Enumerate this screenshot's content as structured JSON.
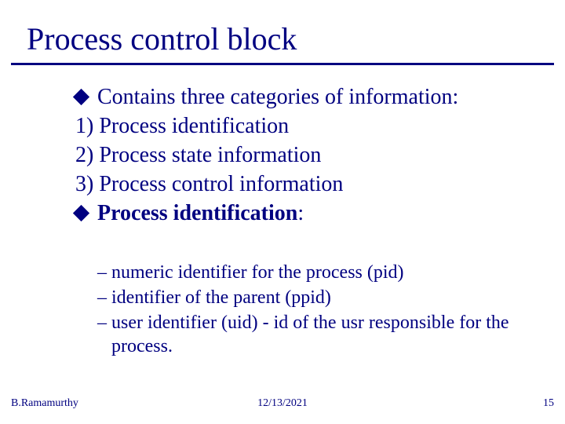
{
  "title": "Process control block",
  "body": {
    "bullet1": "Contains three categories of information:",
    "line1": "1) Process identification",
    "line2": "2) Process state information",
    "line3": "3) Process control information",
    "bullet2_bold": "Process identification",
    "bullet2_rest": ":"
  },
  "sub": {
    "item1": "numeric identifier for the process (pid)",
    "item2": "identifier of the parent (ppid)",
    "item3": "user identifier (uid) - id of the usr responsible for the process."
  },
  "footer": {
    "left": "B.Ramamurthy",
    "center": "12/13/2021",
    "right": "15"
  },
  "colors": {
    "text": "#000080",
    "background": "#ffffff"
  }
}
